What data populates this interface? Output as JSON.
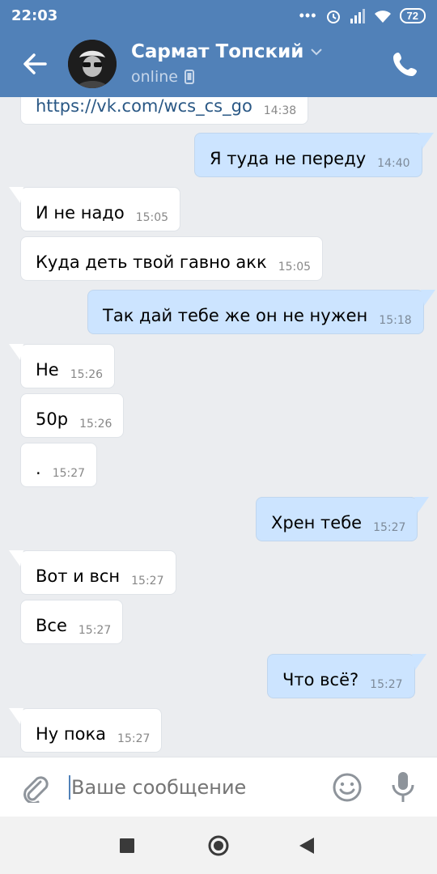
{
  "status": {
    "time": "22:03",
    "battery": "72"
  },
  "header": {
    "name": "Сармат Топский",
    "presence": "online"
  },
  "messages": [
    {
      "dir": "in",
      "text": "https://vk.com/wcs_cs_go",
      "time": "14:38",
      "link": true
    },
    {
      "dir": "out",
      "text": "Я туда не переду",
      "time": "14:40"
    },
    {
      "dir": "in",
      "text": "И не надо",
      "time": "15:05"
    },
    {
      "dir": "in",
      "text": "Куда деть твой гавно акк",
      "time": "15:05"
    },
    {
      "dir": "out",
      "text": "Так дай тебе же он не нужен",
      "time": "15:18"
    },
    {
      "dir": "in",
      "text": "Не",
      "time": "15:26"
    },
    {
      "dir": "in",
      "text": "50р",
      "time": "15:26"
    },
    {
      "dir": "in",
      "text": ".",
      "time": "15:27"
    },
    {
      "dir": "out",
      "text": "Хрен тебе",
      "time": "15:27"
    },
    {
      "dir": "in",
      "text": "Вот и всн",
      "time": "15:27"
    },
    {
      "dir": "in",
      "text": "Все",
      "time": "15:27"
    },
    {
      "dir": "out",
      "text": "Что всё?",
      "time": "15:27"
    },
    {
      "dir": "in",
      "text": "Ну пока",
      "time": "15:27"
    }
  ],
  "composer": {
    "placeholder": "Ваше сообщение"
  },
  "icons": {
    "back": "arrow-left-icon",
    "call": "phone-icon",
    "attach": "paperclip-icon",
    "emoji": "smile-icon",
    "mic": "microphone-icon",
    "device": "mobile-device-icon",
    "nav_recent": "square-icon",
    "nav_home": "circle-icon",
    "nav_back": "triangle-back-icon"
  },
  "colors": {
    "brand": "#5181b8",
    "incoming": "#ffffff",
    "outgoing": "#cce4ff",
    "chat_bg": "#ebedf0"
  }
}
